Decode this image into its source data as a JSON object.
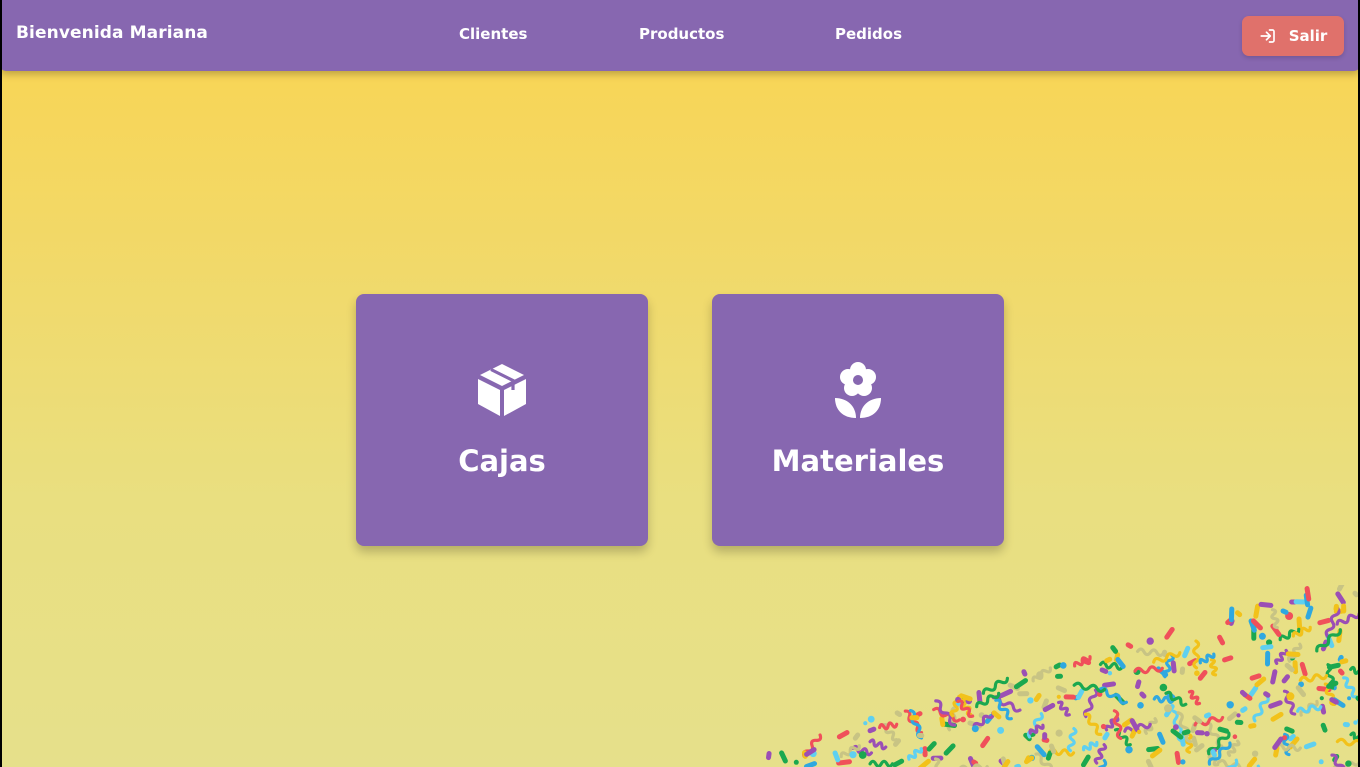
{
  "header": {
    "welcome": "Bienvenida Mariana",
    "nav": [
      "Clientes",
      "Productos",
      "Pedidos"
    ],
    "logout_label": "Salir",
    "logout_icon": "login-arrow-icon"
  },
  "cards": [
    {
      "label": "Cajas",
      "icon": "box-icon"
    },
    {
      "label": "Materiales",
      "icon": "flower-icon"
    }
  ],
  "colors": {
    "navbar": "#8767b0",
    "card": "#8767b0",
    "logout": "#e0716b",
    "background_top": "#fad450",
    "background_bottom": "#e6e08b"
  },
  "decoration": {
    "name": "confetti-decoration"
  }
}
